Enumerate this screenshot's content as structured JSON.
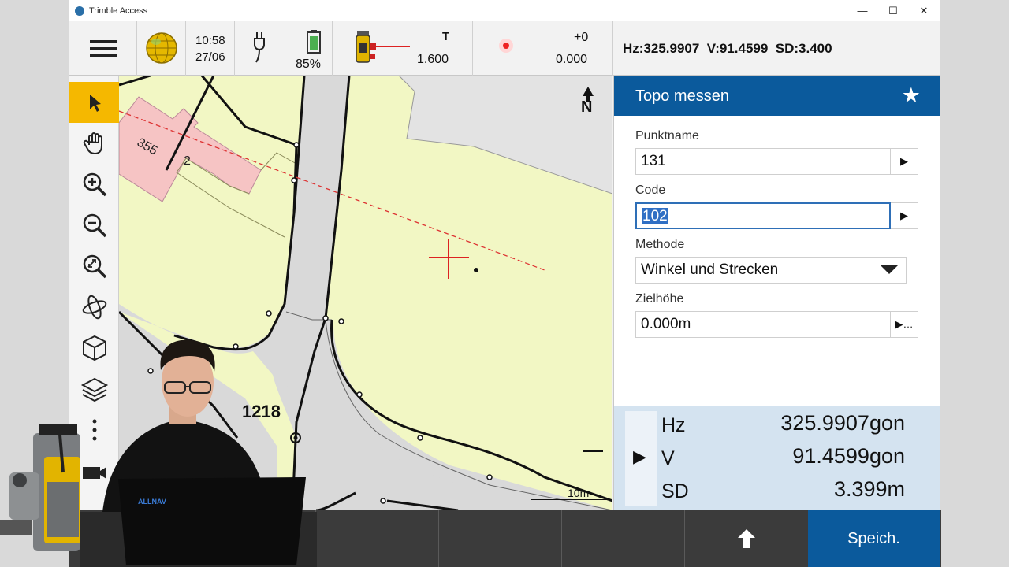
{
  "window": {
    "title": "Trimble Access",
    "min": "—",
    "max": "☐",
    "close": "✕"
  },
  "status": {
    "time": "10:58",
    "date": "27/06",
    "battery": "85%",
    "target_label": "T",
    "target_height": "1.600",
    "prism_const": "+0",
    "prism_value": "0.000",
    "readout": "Hz:325.9907  V:91.4599  SD:3.400"
  },
  "map": {
    "parcel_355": "355",
    "parcel_2": "2",
    "parcel_1218": "1218",
    "north": "N",
    "scale": "10m"
  },
  "panel": {
    "title": "Topo messen",
    "punktname_label": "Punktname",
    "punktname_value": "131",
    "code_label": "Code",
    "code_value": "102",
    "methode_label": "Methode",
    "methode_value": "Winkel und Strecken",
    "zielhoehe_label": "Zielhöhe",
    "zielhoehe_value": "0.000m",
    "obs": [
      {
        "label": "Hz",
        "value": "325.9907gon"
      },
      {
        "label": "V",
        "value": "91.4599gon"
      },
      {
        "label": "SD",
        "value": "3.399m"
      }
    ]
  },
  "bottom": {
    "save_label": "Speich."
  },
  "overlay": {
    "laptop_brand": "ALLNAV"
  },
  "colors": {
    "accent": "#0b5a9c",
    "map_bg": "#f2f7c4",
    "building": "#f6c4c4",
    "road": "#d9d9d9"
  }
}
